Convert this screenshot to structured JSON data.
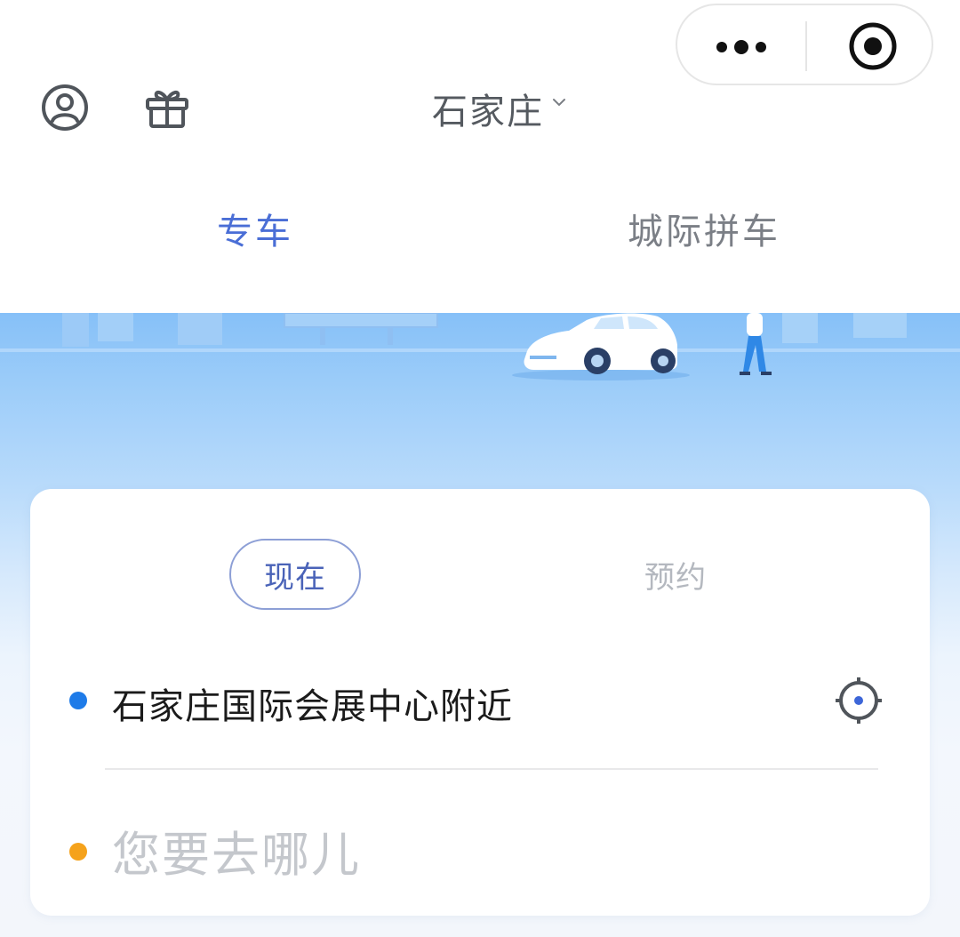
{
  "header": {
    "city": "石家庄",
    "icons": {
      "user": "user-circle-icon",
      "gift": "gift-icon",
      "city_dropdown": "chevron-down-icon"
    }
  },
  "capsule": {
    "icons": {
      "more": "more-dots-icon",
      "close": "target-close-icon"
    }
  },
  "service_tabs": [
    {
      "label": "专车",
      "active": true
    },
    {
      "label": "城际拼车",
      "active": false
    }
  ],
  "booking": {
    "modes": [
      {
        "label": "现在",
        "active": true
      },
      {
        "label": "预约",
        "active": false
      }
    ],
    "pickup": "石家庄国际会展中心附近",
    "destination_placeholder": "您要去哪儿",
    "destination_value": ""
  },
  "colors": {
    "accent": "#4a6ed6",
    "pickup_dot": "#1e7be8",
    "destination_dot": "#f5a21b"
  }
}
